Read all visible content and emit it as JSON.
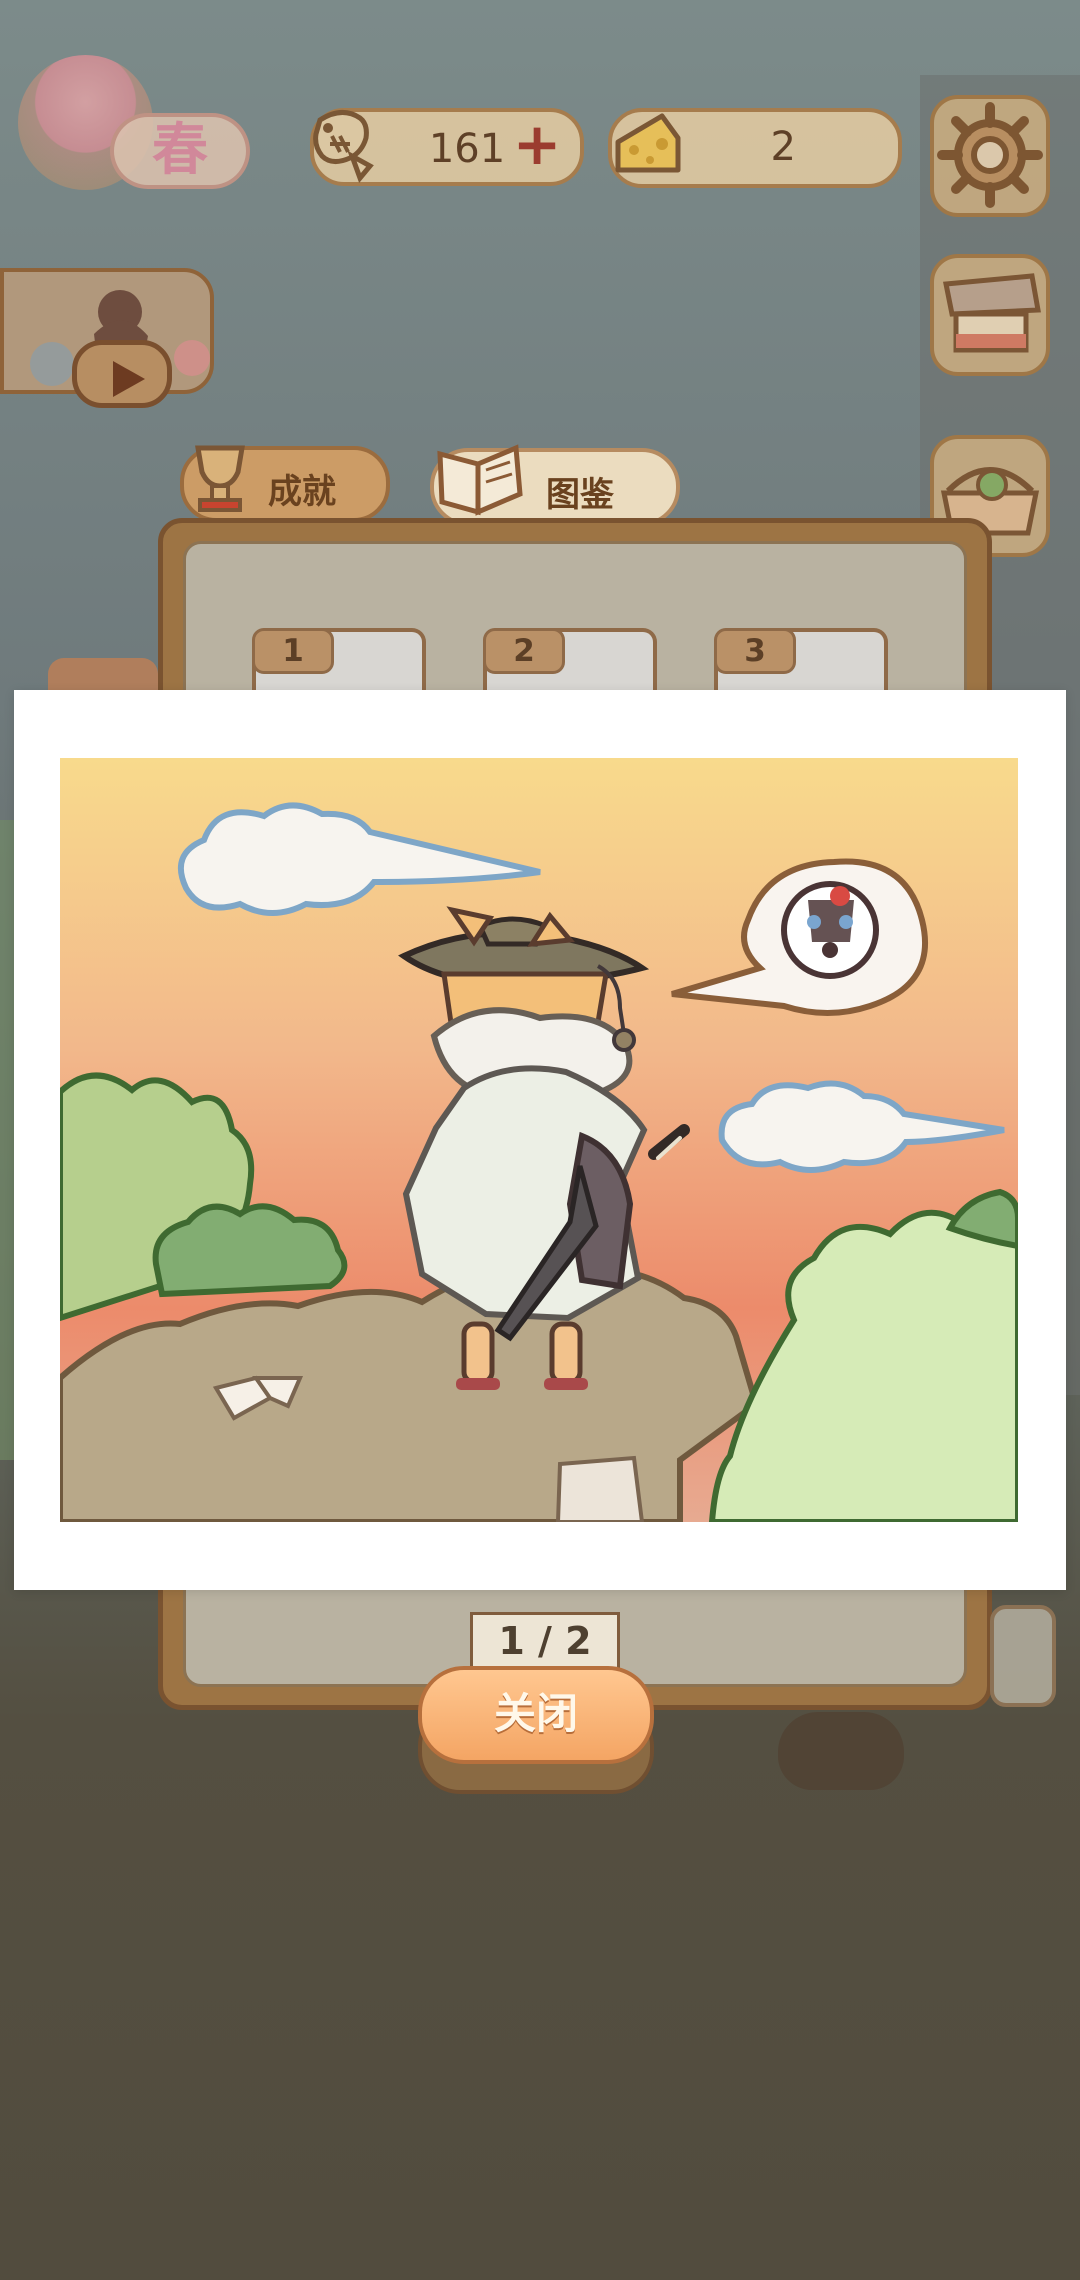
{
  "season": {
    "label": "春"
  },
  "hud": {
    "fish_count": "161",
    "cheese_count": "2"
  },
  "tabs": [
    {
      "label": "成就"
    },
    {
      "label": "图鉴"
    }
  ],
  "slots": [
    {
      "number": "1"
    },
    {
      "number": "2"
    },
    {
      "number": "3"
    }
  ],
  "pagination": {
    "text": "1 / 2"
  },
  "close_button": {
    "label": "关闭"
  },
  "icons": {
    "fish": "fish-bone-icon",
    "plus": "plus-icon",
    "cheese": "cheese-icon",
    "settings": "gear-icon",
    "shop": "shop-stall-icon",
    "basket": "basket-icon",
    "play": "play-icon",
    "trophy": "trophy-icon",
    "book": "open-book-icon"
  },
  "colors": {
    "accent": "#f4a564",
    "panel": "#9d7444",
    "close": "#ffc790"
  }
}
